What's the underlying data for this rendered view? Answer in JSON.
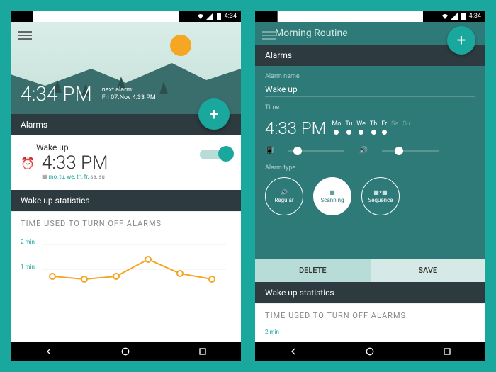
{
  "status": {
    "time": "4:34"
  },
  "left": {
    "hero_time": "4:34 PM",
    "next_alarm_label": "next alarm:",
    "next_alarm_value": "Fri 07.Nov 4:33 PM",
    "alarms_header": "Alarms",
    "alarm": {
      "name": "Wake up",
      "time": "4:33 PM",
      "days_on": "mo, tu, we, th, fr,",
      "days_off": " sa, su"
    },
    "stats_header": "Wake up statistics",
    "stats_title": "TIME USED TO TURN OFF ALARMS"
  },
  "right": {
    "title": "Morning Routine",
    "alarms_header": "Alarms",
    "name_label": "Alarm name",
    "name_value": "Wake up",
    "time_label": "Time",
    "time_value": "4:33 PM",
    "days": [
      "Mo",
      "Tu",
      "We",
      "Th",
      "Fr",
      "Sa",
      "Su"
    ],
    "type_label": "Alarm type",
    "types": {
      "regular": "Regular",
      "scanning": "Scanning",
      "sequence": "Sequence"
    },
    "delete": "DELETE",
    "save": "SAVE",
    "stats_header": "Wake up statistics",
    "stats_title": "TIME USED TO TURN OFF ALARMS"
  },
  "chart_data": {
    "type": "line",
    "title": "TIME USED TO TURN OFF ALARMS",
    "ylabel": "minutes",
    "yticks": [
      "2 min",
      "1 min"
    ],
    "ylim": [
      0,
      2
    ],
    "x": [
      1,
      2,
      3,
      4,
      5,
      6
    ],
    "values": [
      0.6,
      0.5,
      0.6,
      1.2,
      0.7,
      0.5
    ]
  }
}
